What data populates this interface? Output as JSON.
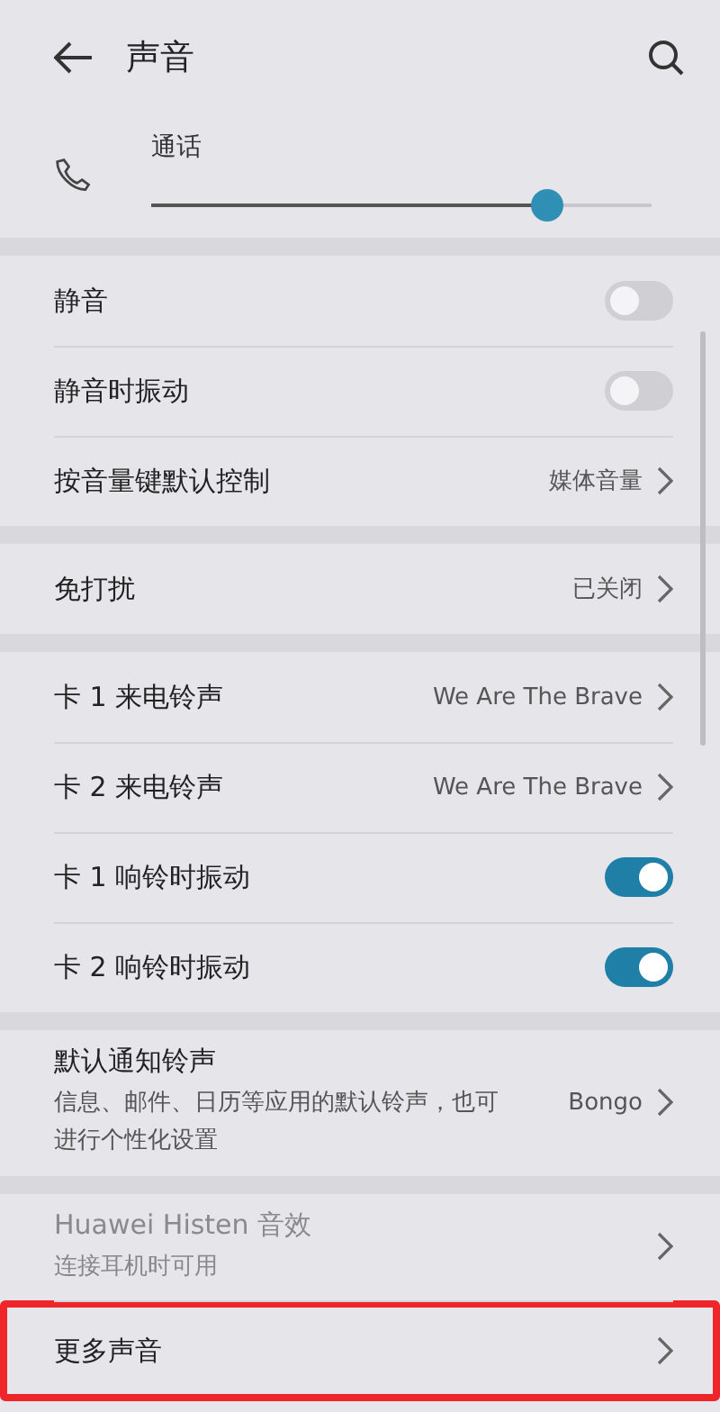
{
  "header": {
    "title": "声音"
  },
  "volume": {
    "label": "通话",
    "level": 0.79
  },
  "sections": [
    {
      "items": [
        {
          "kind": "toggle",
          "label": "静音",
          "on": false
        },
        {
          "kind": "toggle",
          "label": "静音时振动",
          "on": false
        },
        {
          "kind": "link",
          "label": "按音量键默认控制",
          "value": "媒体音量"
        }
      ]
    },
    {
      "items": [
        {
          "kind": "link",
          "label": "免打扰",
          "value": "已关闭"
        }
      ]
    },
    {
      "items": [
        {
          "kind": "link",
          "label": "卡 1 来电铃声",
          "value": "We Are The Brave"
        },
        {
          "kind": "link",
          "label": "卡 2 来电铃声",
          "value": "We Are The Brave"
        },
        {
          "kind": "toggle",
          "label": "卡 1 响铃时振动",
          "on": true
        },
        {
          "kind": "toggle",
          "label": "卡 2 响铃时振动",
          "on": true
        }
      ]
    },
    {
      "items": [
        {
          "kind": "link",
          "label": "默认通知铃声",
          "summary": "信息、邮件、日历等应用的默认铃声，也可进行个性化设置",
          "value": "Bongo"
        }
      ]
    },
    {
      "items": [
        {
          "kind": "link",
          "label": "Huawei Histen 音效",
          "summary": "连接耳机时可用",
          "disabled": true
        },
        {
          "kind": "link",
          "label": "更多声音",
          "highlighted": true
        }
      ]
    }
  ]
}
